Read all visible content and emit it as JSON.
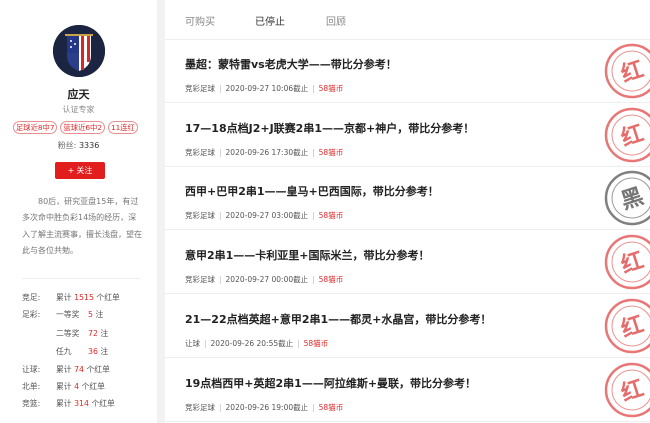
{
  "profile": {
    "name": "应天",
    "cert": "认证专家",
    "tags": [
      "足球近8中7",
      "篮球近6中2",
      "11连红"
    ],
    "fans_label": "粉丝:",
    "fans_count": "3336",
    "follow_label": "关注",
    "bio": "80后，研究亚盘15年，有过多次命中胜负彩14场的经历，深入了解主流赛事，擅长浅盘，望在此与各位共勉。",
    "stats": {
      "jingcai": {
        "label": "竞足:",
        "pre": "累计",
        "num": "1515",
        "post": "个红单"
      },
      "zucai_label": "足彩:",
      "zucai": [
        {
          "sub": "一等奖",
          "num": "5",
          "post": "注"
        },
        {
          "sub": "二等奖",
          "num": "72",
          "post": "注"
        },
        {
          "sub": "任九",
          "num": "36",
          "post": "注"
        }
      ],
      "rangqiu": {
        "label": "让球:",
        "pre": "累计",
        "num": "74",
        "post": "个红单"
      },
      "beidan": {
        "label": "北单:",
        "pre": "累计",
        "num": "4",
        "post": "个红单"
      },
      "jinglan": {
        "label": "竞篮:",
        "pre": "累计",
        "num": "314",
        "post": "个红单"
      }
    }
  },
  "tabs": [
    "可购买",
    "已停止",
    "回顾"
  ],
  "active_tab": "已停止",
  "items": [
    {
      "title": "墨超：蒙特雷vs老虎大学——带比分参考！",
      "type": "竞彩足球",
      "time": "2020-09-27 10:06截止",
      "price": "58猫币",
      "stamp": "红",
      "stamp_color": "#e04848"
    },
    {
      "title": "17—18点档J2+J联赛2串1——京都+神户，带比分参考！",
      "type": "竞彩足球",
      "time": "2020-09-26 17:30截止",
      "price": "58猫币",
      "stamp": "红",
      "stamp_color": "#e04848"
    },
    {
      "title": "西甲+巴甲2串1——皇马+巴西国际，带比分参考！",
      "type": "竞彩足球",
      "time": "2020-09-27 03:00截止",
      "price": "58猫币",
      "stamp": "黑",
      "stamp_color": "#555555"
    },
    {
      "title": "意甲2串1——卡利亚里+国际米兰，带比分参考！",
      "type": "竞彩足球",
      "time": "2020-09-27 00:00截止",
      "price": "58猫币",
      "stamp": "红",
      "stamp_color": "#e04848"
    },
    {
      "title": "21—22点档英超+意甲2串1——都灵+水晶宫，带比分参考！",
      "type": "让球",
      "time": "2020-09-26 20:55截止",
      "price": "58猫币",
      "stamp": "红",
      "stamp_color": "#e04848"
    },
    {
      "title": "19点档西甲+英超2串1——阿拉维斯+曼联，带比分参考！",
      "type": "竞彩足球",
      "time": "2020-09-26 19:00截止",
      "price": "58猫币",
      "stamp": "红",
      "stamp_color": "#e04848"
    }
  ]
}
